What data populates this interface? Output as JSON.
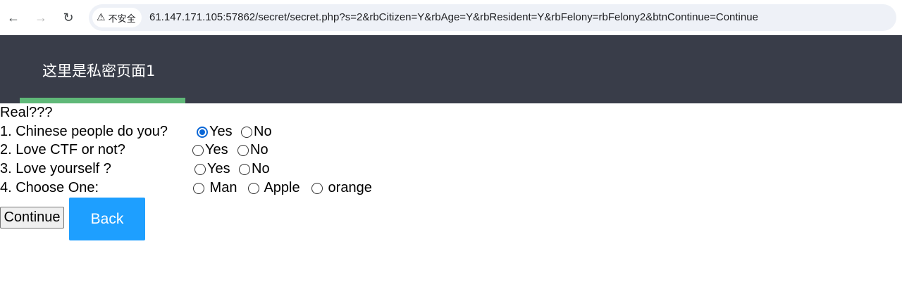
{
  "browser": {
    "back_icon": "arrow-left-icon",
    "forward_icon": "arrow-right-icon",
    "reload_icon": "reload-icon",
    "security_label": "不安全",
    "url": "61.147.171.105:57862/secret/secret.php?s=2&rbCitizen=Y&rbAge=Y&rbResident=Y&rbFelony=rbFelony2&btnContinue=Continue"
  },
  "header": {
    "title": "这里是私密页面1",
    "accent_color": "#5fb878",
    "background_color": "#393d49"
  },
  "form": {
    "intro": "Real???",
    "questions": [
      {
        "label": "1. Chinese people do you?",
        "options": [
          {
            "label": "Yes",
            "checked": true
          },
          {
            "label": "No",
            "checked": false
          }
        ]
      },
      {
        "label": "2. Love CTF or not?",
        "options": [
          {
            "label": "Yes",
            "checked": false
          },
          {
            "label": "No",
            "checked": false
          }
        ]
      },
      {
        "label": "3. Love yourself ?",
        "options": [
          {
            "label": "Yes",
            "checked": false
          },
          {
            "label": "No",
            "checked": false
          }
        ]
      },
      {
        "label": "4. Choose One:",
        "options": [
          {
            "label": " Man",
            "checked": false
          },
          {
            "label": " Apple",
            "checked": false
          },
          {
            "label": " orange",
            "checked": false
          }
        ]
      }
    ]
  },
  "buttons": {
    "continue_label": "Continue",
    "back_label": "Back",
    "back_color": "#1e9fff"
  }
}
